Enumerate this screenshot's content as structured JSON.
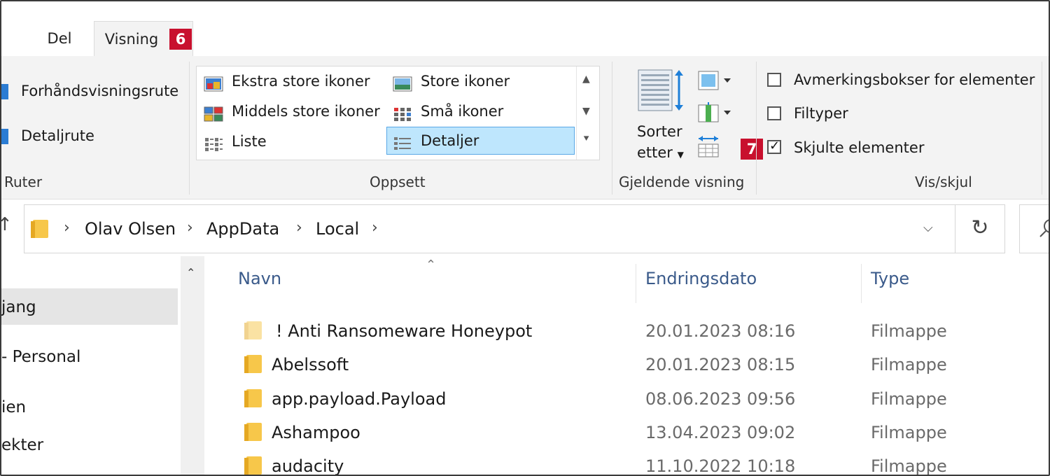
{
  "tabs": {
    "del": "Del",
    "visning": "Visning"
  },
  "badges": {
    "tab": "6",
    "hidden": "7"
  },
  "panes": {
    "preview": "Forhåndsvisningsrute",
    "details": "Detaljrute",
    "label": "Ruter"
  },
  "layout": {
    "items": [
      "Ekstra store ikoner",
      "Store ikoner",
      "Middels store ikoner",
      "Små ikoner",
      "Liste",
      "Detaljer"
    ],
    "selected": "Detaljer",
    "label": "Oppsett"
  },
  "current_view": {
    "sort_line1": "Sorter",
    "sort_line2": "etter",
    "label": "Gjeldende visning"
  },
  "show_hide": {
    "checkboxes_label": "Avmerkingsbokser for elementer",
    "file_ext_label": "Filtyper",
    "hidden_label": "Skjulte elementer",
    "checkboxes_checked": false,
    "file_ext_checked": false,
    "hidden_checked": true,
    "label": "Vis/skjul"
  },
  "address": {
    "crumbs": [
      "Olav Olsen",
      "AppData",
      "Local"
    ]
  },
  "nav": {
    "items": [
      "jang",
      "- Personal",
      "ien",
      "ekter"
    ]
  },
  "columns": {
    "name": "Navn",
    "date": "Endringsdato",
    "type": "Type"
  },
  "files": [
    {
      "name": "! Anti Ransomeware Honeypot",
      "date": "20.01.2023 08:16",
      "type": "Filmappe",
      "faded": true
    },
    {
      "name": "Abelssoft",
      "date": "20.01.2023 08:15",
      "type": "Filmappe",
      "faded": false
    },
    {
      "name": "app.payload.Payload",
      "date": "08.06.2023 09:56",
      "type": "Filmappe",
      "faded": false
    },
    {
      "name": "Ashampoo",
      "date": "13.04.2023 09:02",
      "type": "Filmappe",
      "faded": false
    },
    {
      "name": "audacity",
      "date": "11.10.2022 10:18",
      "type": "Filmappe",
      "faded": false
    }
  ],
  "colors": {
    "accent_badge": "#c8102e",
    "selection": "#bee6fd",
    "folder": "#f7c74a"
  }
}
